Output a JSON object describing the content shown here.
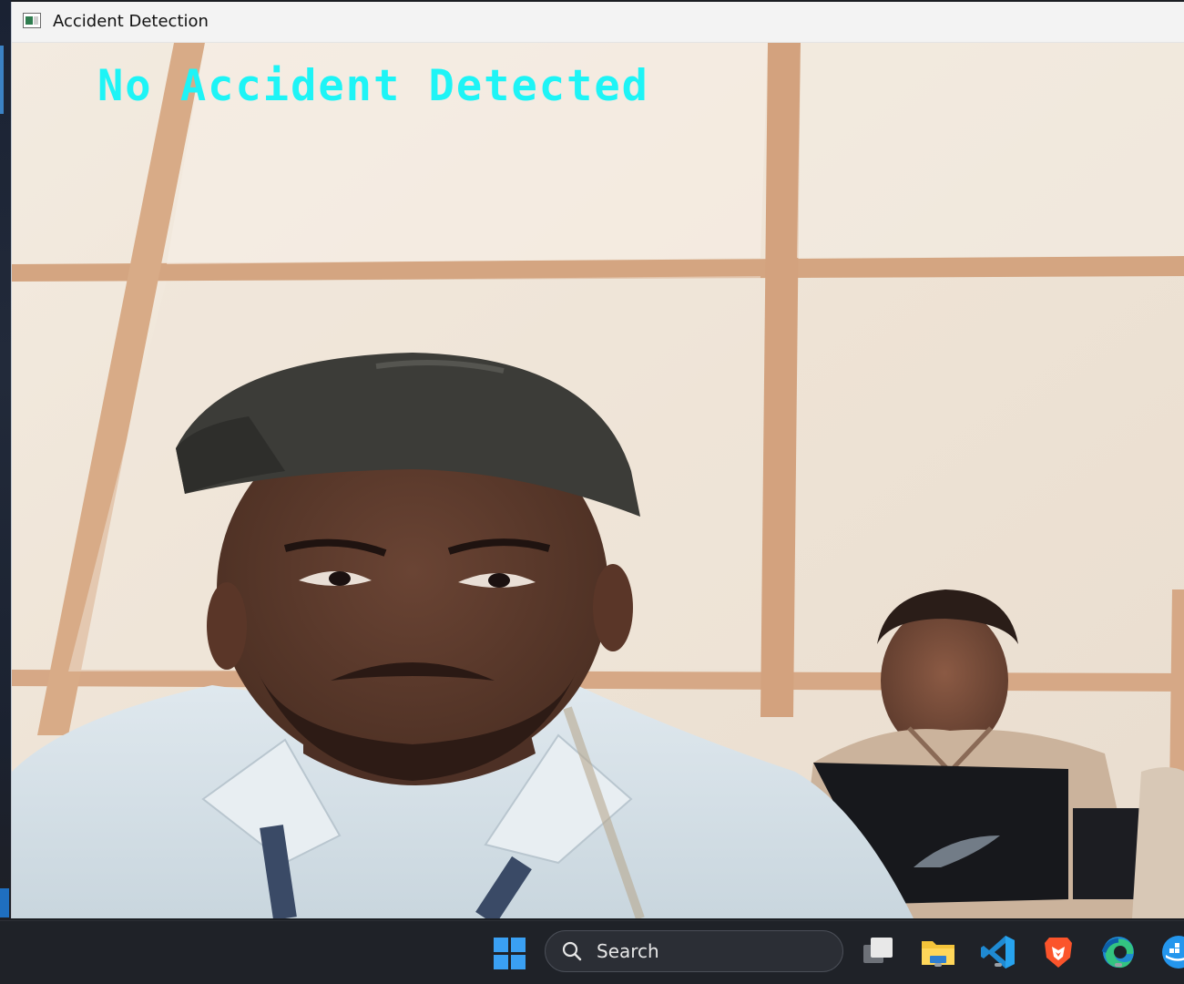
{
  "window": {
    "title": "Accident Detection"
  },
  "frame": {
    "overlay_status": "No Accident Detected",
    "overlay_color": "#1ef4f6"
  },
  "taskbar": {
    "search_label": "Search",
    "items": [
      {
        "name": "start",
        "icon": "windows-start-icon"
      },
      {
        "name": "task-view",
        "icon": "task-view-icon"
      },
      {
        "name": "file-explorer",
        "icon": "folder-icon",
        "running": true
      },
      {
        "name": "vscode",
        "icon": "vscode-icon",
        "running": true
      },
      {
        "name": "brave",
        "icon": "brave-lion-icon"
      },
      {
        "name": "edge",
        "icon": "edge-icon",
        "running": true
      },
      {
        "name": "docker",
        "icon": "docker-icon"
      }
    ]
  }
}
